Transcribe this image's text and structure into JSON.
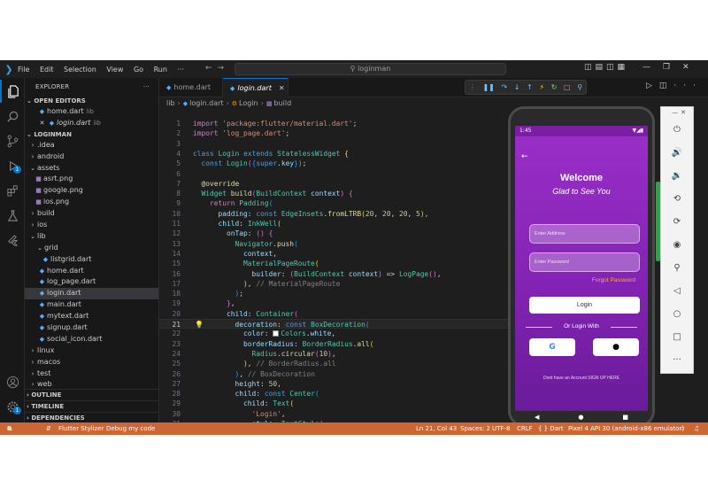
{
  "window": {
    "menus": [
      "File",
      "Edit",
      "Selection",
      "View",
      "Go",
      "Run",
      "···"
    ],
    "search_placeholder": "loginman"
  },
  "explorer": {
    "title": "EXPLORER",
    "open_editors_label": "OPEN EDITORS",
    "open_editors": [
      {
        "name": "home.dart",
        "dir": "lib"
      },
      {
        "name": "login.dart",
        "dir": "lib"
      }
    ],
    "project_label": "LOGINMAN",
    "tree": [
      {
        "name": ".idea",
        "kind": "folder"
      },
      {
        "name": "android",
        "kind": "folder"
      },
      {
        "name": "assets",
        "kind": "folder-open"
      },
      {
        "name": "asrt.png",
        "kind": "image"
      },
      {
        "name": "google.png",
        "kind": "image"
      },
      {
        "name": "ios.png",
        "kind": "image"
      },
      {
        "name": "build",
        "kind": "folder"
      },
      {
        "name": "ios",
        "kind": "folder"
      },
      {
        "name": "lib",
        "kind": "folder-open"
      },
      {
        "name": "grid",
        "kind": "folder-open"
      },
      {
        "name": "listgrid.dart",
        "kind": "dart"
      },
      {
        "name": "home.dart",
        "kind": "dart"
      },
      {
        "name": "log_page.dart",
        "kind": "dart"
      },
      {
        "name": "login.dart",
        "kind": "dart"
      },
      {
        "name": "main.dart",
        "kind": "dart"
      },
      {
        "name": "mytext.dart",
        "kind": "dart"
      },
      {
        "name": "signup.dart",
        "kind": "dart"
      },
      {
        "name": "social_icon.dart",
        "kind": "dart"
      },
      {
        "name": "linux",
        "kind": "folder"
      },
      {
        "name": "macos",
        "kind": "folder"
      },
      {
        "name": "test",
        "kind": "folder"
      },
      {
        "name": "web",
        "kind": "folder"
      }
    ],
    "outline_label": "OUTLINE",
    "timeline_label": "TIMELINE",
    "dependencies_label": "DEPENDENCIES"
  },
  "activity": {
    "extensions_badge": "1",
    "settings_badge": "1"
  },
  "tabs": [
    {
      "name": "home.dart",
      "active": false
    },
    {
      "name": "login.dart",
      "active": true
    }
  ],
  "breadcrumb": [
    "lib",
    "login.dart",
    "Login",
    "build"
  ],
  "editor": {
    "current_line": 21
  },
  "emulator": {
    "time": "1:45",
    "welcome": "Welcome",
    "subtitle": "Glad to See You",
    "email_placeholder": "Enter Address",
    "password_placeholder": "Enter Password",
    "forgot": "Forgot Password",
    "login": "Login",
    "or_login_with": "Or Login With",
    "signup_text": "Dont have an Account SIGN UP HERE"
  },
  "statusbar": {
    "errors": "0",
    "warnings": "0",
    "flutter": "Flutter Stylizer",
    "debug": "Debug my code",
    "position": "Ln 21, Col 43",
    "spaces": "Spaces: 2",
    "encoding": "UTF-8",
    "eol": "CRLF",
    "language": "{ } Dart",
    "device": "Pixel 4 API 30 (android-x86 emulator)"
  },
  "colors": {
    "statusbar": "#cc6633",
    "accent": "#0078d4",
    "app_purple": "#8e24aa"
  }
}
